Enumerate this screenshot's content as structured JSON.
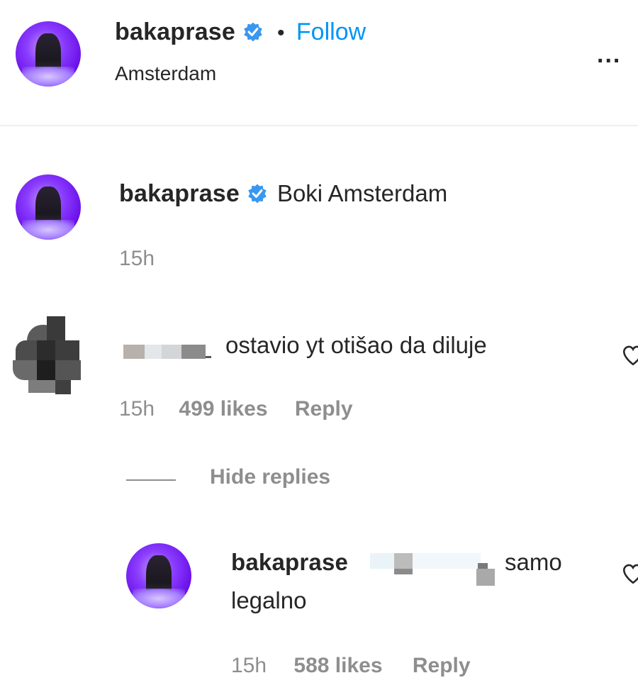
{
  "header": {
    "username": "bakaprase",
    "separator": "•",
    "follow_label": "Follow",
    "location": "Amsterdam",
    "more_label": "..."
  },
  "caption": {
    "username": "bakaprase",
    "text": "Boki Amsterdam",
    "time": "15h"
  },
  "comment": {
    "text": "ostavio yt otišao da diluje",
    "time": "15h",
    "likes": "499 likes",
    "reply_label": "Reply"
  },
  "hide_replies_label": "Hide replies",
  "reply": {
    "username": "bakaprase",
    "text_1": "samo",
    "text_2": "legalno",
    "time": "15h",
    "likes": "588 likes",
    "reply_label": "Reply"
  },
  "colors": {
    "accent": "#0095f6",
    "verified": "#3897f0",
    "muted": "#8e8e8e"
  }
}
